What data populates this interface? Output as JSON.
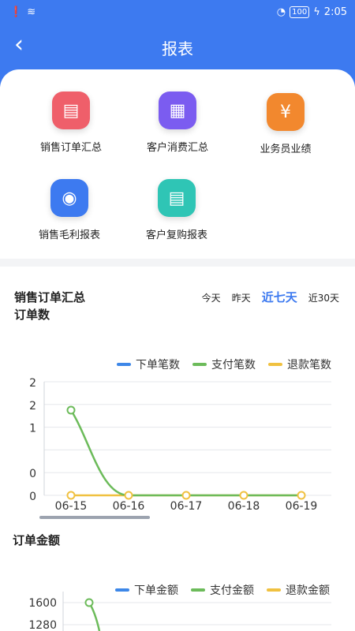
{
  "status_bar": {
    "time": "2:05",
    "battery": "100"
  },
  "header": {
    "title": "报表",
    "back_icon": "chevron-left-icon"
  },
  "menu": [
    {
      "label": "销售订单汇总",
      "icon": "chart-icon",
      "color": "#ef5f6a",
      "glyph": "▤"
    },
    {
      "label": "客户消费汇总",
      "icon": "clipboard-icon",
      "color": "#7b5cf0",
      "glyph": "▦"
    },
    {
      "label": "业务员业绩",
      "icon": "yen-icon",
      "color": "#f2882e",
      "glyph": "¥"
    },
    {
      "label": "销售毛利报表",
      "icon": "coins-icon",
      "color": "#3d7af0",
      "glyph": "◉"
    },
    {
      "label": "客户复购报表",
      "icon": "chart-icon",
      "color": "#2fc5b5",
      "glyph": "▤"
    }
  ],
  "summary": {
    "title": "销售订单汇总",
    "range_tabs": [
      "今天",
      "昨天",
      "近七天",
      "近30天"
    ],
    "active_range": "近七天"
  },
  "colors": {
    "series1": "#3d87e8",
    "series2": "#6cbb5a",
    "series3": "#f0c140"
  },
  "chart_data": [
    {
      "type": "line",
      "title": "订单数",
      "x": [
        "06-15",
        "06-16",
        "06-17",
        "06-18",
        "06-19"
      ],
      "y_ticks": [
        "2",
        "2",
        "1",
        "0",
        "0"
      ],
      "ylim": [
        0,
        2
      ],
      "legend": "top-right",
      "series": [
        {
          "name": "下单笔数",
          "values": [
            null,
            null,
            null,
            null,
            null
          ]
        },
        {
          "name": "支付笔数",
          "values": [
            1.5,
            0,
            0,
            0,
            0
          ]
        },
        {
          "name": "退款笔数",
          "values": [
            0,
            0,
            0,
            0,
            0
          ]
        }
      ]
    },
    {
      "type": "line",
      "title": "订单金额",
      "y_ticks": [
        "1600",
        "1280"
      ],
      "legend": "top-right",
      "series": [
        {
          "name": "下单金额",
          "values": []
        },
        {
          "name": "支付金额",
          "values": [
            1600
          ]
        },
        {
          "name": "退款金额",
          "values": []
        }
      ]
    }
  ]
}
